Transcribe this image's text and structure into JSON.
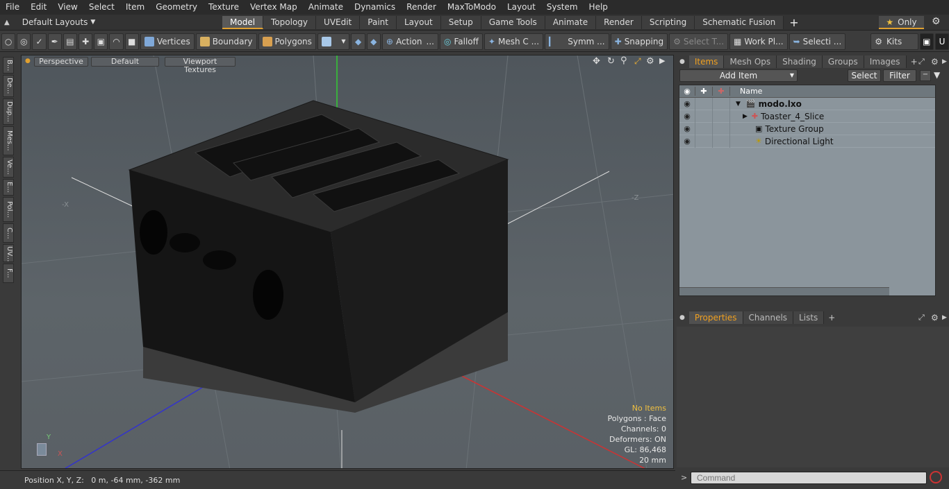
{
  "menu": [
    "File",
    "Edit",
    "View",
    "Select",
    "Item",
    "Geometry",
    "Texture",
    "Vertex Map",
    "Animate",
    "Dynamics",
    "Render",
    "MaxToModo",
    "Layout",
    "System",
    "Help"
  ],
  "layout_selector": "Default Layouts",
  "mode_tabs": [
    "Model",
    "Topology",
    "UVEdit",
    "Paint",
    "Layout",
    "Setup",
    "Game Tools",
    "Animate",
    "Render",
    "Scripting",
    "Schematic Fusion"
  ],
  "active_tab": "Model",
  "only_label": "Only",
  "toolbar": {
    "vertices": "Vertices",
    "boundary": "Boundary",
    "polygons": "Polygons",
    "action": "Action",
    "falloff": "Falloff",
    "mesh": "Mesh C ...",
    "symm": "Symm ...",
    "snapping": "Snapping",
    "select_t": "Select T...",
    "work_pl": "Work Pl...",
    "selecti": "Selecti ...",
    "kits": "Kits"
  },
  "left_tabs": [
    "B...",
    "De...",
    "Dup...",
    "Mes...",
    "Ve...",
    "E...",
    "Pol...",
    "C...",
    "UV...",
    "F..."
  ],
  "viewport": {
    "perspective": "Perspective",
    "default": "Default",
    "textures": "Viewport Textures",
    "axis_neg_x": "-X",
    "axis_neg_z": "-Z",
    "gizmo_y": "Y",
    "gizmo_x": "X"
  },
  "stats": {
    "no_items": "No Items",
    "polygons": "Polygons : Face",
    "channels": "Channels: 0",
    "deformers": "Deformers: ON",
    "gl": "GL: 86,468",
    "scale": "20 mm"
  },
  "status": "Position X, Y, Z:   0 m, -64 mm, -362 mm",
  "panel": {
    "tabs": [
      "Items",
      "Mesh Ops",
      "Shading",
      "Groups",
      "Images"
    ],
    "active_tab": "Items",
    "add_item": "Add Item",
    "select": "Select",
    "filter": "Filter",
    "name_col": "Name",
    "tree": [
      {
        "label": "modo.lxo",
        "depth": 0,
        "bold": true,
        "icon": "scene-icon"
      },
      {
        "label": "Toaster_4_Slice",
        "depth": 1,
        "bold": false,
        "icon": "mesh-locator-icon"
      },
      {
        "label": "Texture Group",
        "depth": 1,
        "bold": false,
        "icon": "texture-group-icon"
      },
      {
        "label": "Directional Light",
        "depth": 1,
        "bold": false,
        "icon": "light-icon"
      }
    ]
  },
  "props": {
    "tabs": [
      "Properties",
      "Channels",
      "Lists"
    ],
    "active_tab": "Properties"
  },
  "command_placeholder": "Command",
  "colors": {
    "accent": "#f0a020",
    "grid_x": "#cc3333",
    "grid_y": "#33cc33",
    "grid_z": "#3333cc"
  }
}
